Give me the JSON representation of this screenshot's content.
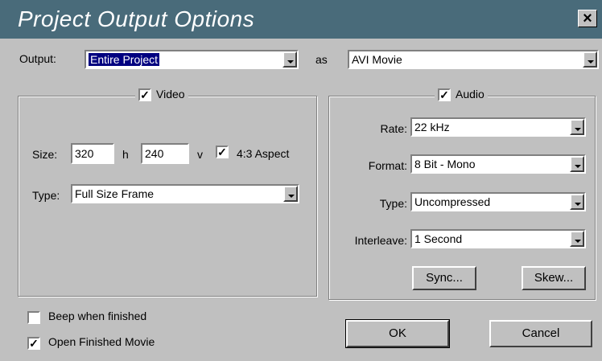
{
  "window": {
    "title": "Project Output Options"
  },
  "output": {
    "label": "Output:",
    "value": "Entire Project",
    "as_label": "as",
    "format": "AVI Movie"
  },
  "video": {
    "label": "Video",
    "checked": true,
    "size_label": "Size:",
    "width": "320",
    "h_label": "h",
    "height": "240",
    "v_label": "v",
    "aspect_label": "4:3 Aspect",
    "aspect_checked": true,
    "type_label": "Type:",
    "type_value": "Full Size Frame"
  },
  "audio": {
    "label": "Audio",
    "checked": true,
    "rate_label": "Rate:",
    "rate_value": "22 kHz",
    "format_label": "Format:",
    "format_value": "8 Bit - Mono",
    "type_label": "Type:",
    "type_value": "Uncompressed",
    "interleave_label": "Interleave:",
    "interleave_value": "1 Second",
    "sync_label": "Sync...",
    "skew_label": "Skew..."
  },
  "options": {
    "beep_label": "Beep when finished",
    "beep_checked": false,
    "open_label": "Open Finished Movie",
    "open_checked": true
  },
  "buttons": {
    "ok": "OK",
    "cancel": "Cancel"
  },
  "icons": {
    "close": "close-icon",
    "check": "checkmark-icon",
    "dropdown": "chevron-down-icon"
  }
}
